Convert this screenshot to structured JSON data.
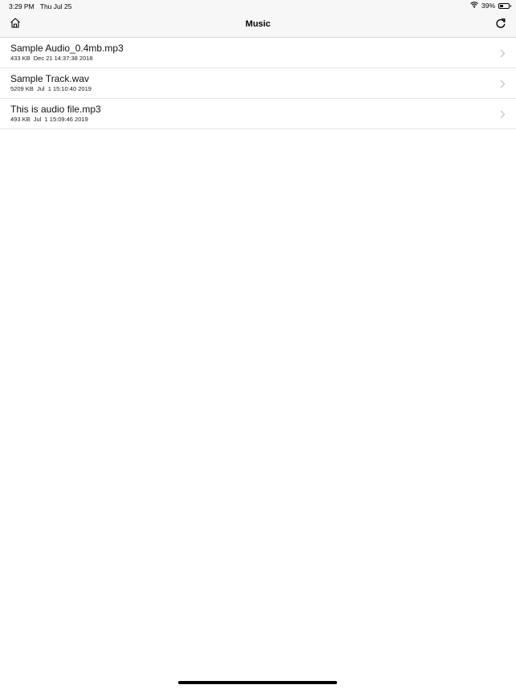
{
  "status_bar": {
    "time": "3:29 PM",
    "date": "Thu Jul 25",
    "battery_text": "39%",
    "battery_level": 0.39,
    "icons": [
      "wifi-icon",
      "battery-icon"
    ]
  },
  "nav": {
    "title": "Music",
    "left_icon": "home-icon",
    "right_icon": "refresh-icon"
  },
  "files": [
    {
      "name": "Sample Audio_0.4mb.mp3",
      "meta": "433 KB  Dec 21 14:37:38 2018"
    },
    {
      "name": "Sample Track.wav",
      "meta": "5209 KB  Jul  1 15:10:40 2019"
    },
    {
      "name": "This is audio file.mp3",
      "meta": "493 KB  Jul  1 15:09:46 2019"
    }
  ],
  "colors": {
    "bar_background": "#f7f7f7",
    "separator": "#e4e4e4",
    "chevron": "#c7c7cc"
  }
}
